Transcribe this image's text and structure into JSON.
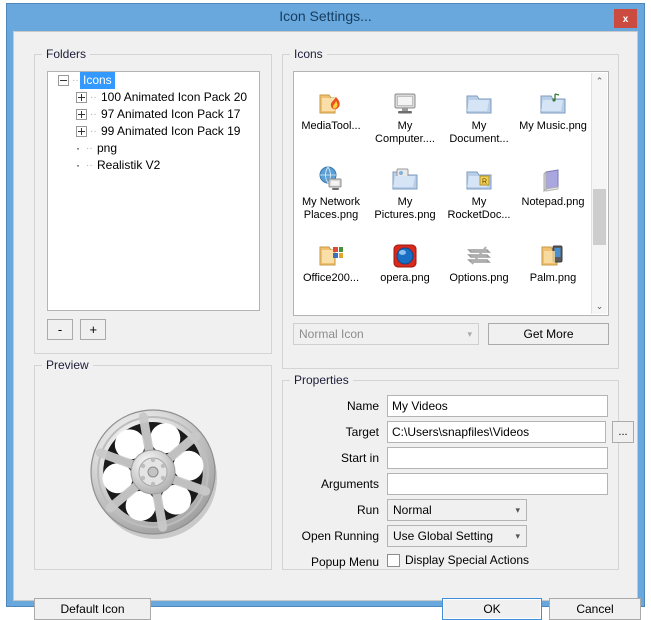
{
  "window": {
    "title": "Icon Settings...",
    "close_label": "x",
    "titlebar_color": "#69a8dd",
    "close_color": "#cc4b40"
  },
  "folders": {
    "legend": "Folders",
    "tree": [
      {
        "label": "Icons",
        "type": "root",
        "expander": "minus",
        "selected": true
      },
      {
        "label": "100 Animated Icon Pack  20",
        "type": "child",
        "expander": "plus",
        "selected": false
      },
      {
        "label": "97 Animated Icon Pack  17",
        "type": "child",
        "expander": "plus",
        "selected": false
      },
      {
        "label": "99 Animated Icon Pack  19",
        "type": "child",
        "expander": "plus",
        "selected": false
      },
      {
        "label": "png",
        "type": "leaf",
        "expander": "none",
        "selected": false
      },
      {
        "label": "Realistik V2",
        "type": "leaf",
        "expander": "none",
        "selected": false
      }
    ],
    "remove_label": "-",
    "add_label": "+",
    "selection_color": "#3399ff"
  },
  "preview": {
    "legend": "Preview",
    "icon_name": "film-reel-icon"
  },
  "icons": {
    "legend": "Icons",
    "items": [
      {
        "label": "MediaTool...",
        "icon": "folder-flame-icon"
      },
      {
        "label": "My Computer....",
        "icon": "monitor-icon"
      },
      {
        "label": "My Document...",
        "icon": "folder-documents-icon"
      },
      {
        "label": "My Music.png",
        "icon": "folder-music-icon"
      },
      {
        "label": "My Network Places.png",
        "icon": "network-globe-icon"
      },
      {
        "label": "My Pictures.png",
        "icon": "folder-pictures-icon"
      },
      {
        "label": "My RocketDoc...",
        "icon": "folder-rocketdock-icon"
      },
      {
        "label": "Notepad.png",
        "icon": "notepad-icon"
      },
      {
        "label": "Office200...",
        "icon": "folder-office-icon"
      },
      {
        "label": "opera.png",
        "icon": "opera-globe-icon"
      },
      {
        "label": "Options.png",
        "icon": "options-sliders-icon"
      },
      {
        "label": "Palm.png",
        "icon": "folder-palm-icon"
      },
      {
        "label": "",
        "icon": "folder-refresh-icon"
      },
      {
        "label": "",
        "icon": "trash-dark-icon"
      },
      {
        "label": "",
        "icon": "trash-blue-icon"
      },
      {
        "label": "",
        "icon": "recycle-bin-icon"
      }
    ],
    "type_combo_value": "Normal Icon",
    "get_more_label": "Get More",
    "scroll_up": "⌃",
    "scroll_down": "⌄"
  },
  "properties": {
    "legend": "Properties",
    "name_label": "Name",
    "name_value": "My Videos",
    "target_label": "Target",
    "target_value": "C:\\Users\\snapfiles\\Videos",
    "browse_label": "...",
    "start_in_label": "Start in",
    "start_in_value": "",
    "arguments_label": "Arguments",
    "arguments_value": "",
    "run_label": "Run",
    "run_value": "Normal",
    "open_running_label": "Open Running",
    "open_running_value": "Use Global Setting",
    "popup_menu_label": "Popup Menu",
    "popup_checkbox_label": "Display Special Actions",
    "popup_checked": false
  },
  "footer": {
    "default_icon_label": "Default Icon",
    "ok_label": "OK",
    "cancel_label": "Cancel"
  }
}
